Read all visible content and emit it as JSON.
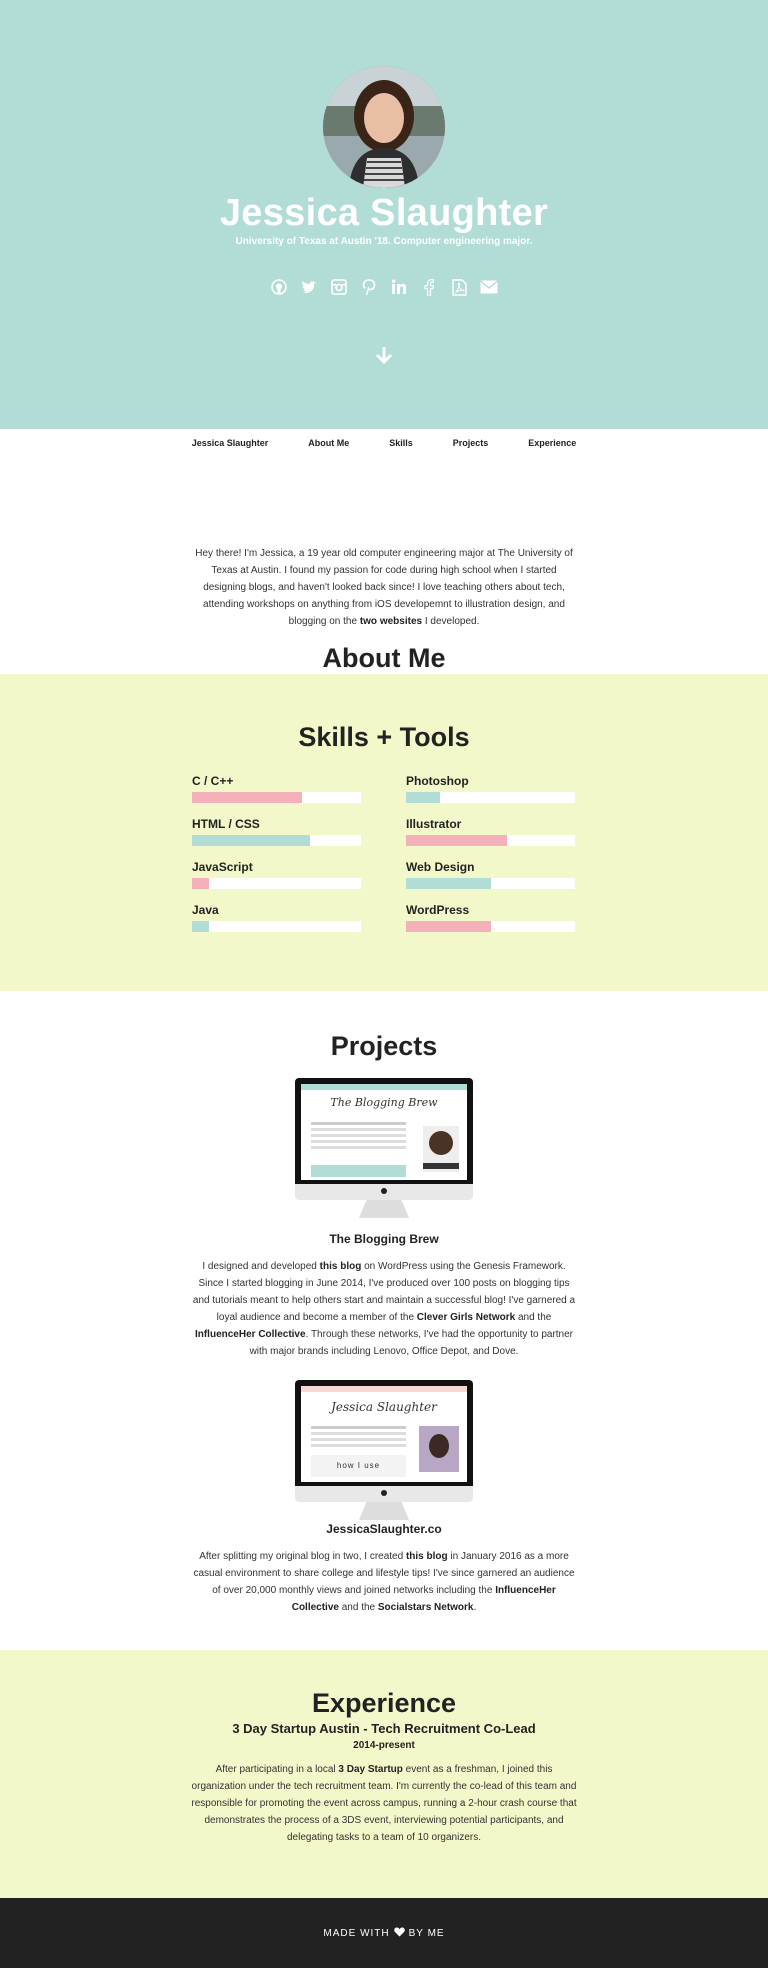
{
  "hero": {
    "name": "Jessica Slaughter",
    "tagline": "University of Texas at Austin '18. Computer engineering major.",
    "social_icons": [
      "github-icon",
      "twitter-icon",
      "instagram-icon",
      "pinterest-icon",
      "linkedin-icon",
      "facebook-icon",
      "pdf-icon",
      "envelope-icon"
    ],
    "down_icon": "arrow-down-icon",
    "bg_color": "#b2dcd6"
  },
  "nav": {
    "items": [
      "Jessica Slaughter",
      "About Me",
      "Skills",
      "Projects",
      "Experience"
    ]
  },
  "about": {
    "title": "About Me",
    "text_before": "Hey there! I'm Jessica, a 19 year old computer engineering major at The University of Texas at Austin. I found my passion for code during high school when I started designing blogs, and haven't looked back since! I love teaching others about tech, attending workshops on anything from iOS developemnt to illustration design, and blogging on the ",
    "text_bold": "two websites",
    "text_after": " I developed."
  },
  "skills": {
    "title": "Skills + Tools",
    "bg_color": "#f2f8c9",
    "pink": "#f4b1b9",
    "teal": "#b2dcd6",
    "items": [
      {
        "name": "C / C++",
        "level": 0.65,
        "color": "pink"
      },
      {
        "name": "Photoshop",
        "level": 0.2,
        "color": "teal"
      },
      {
        "name": "HTML / CSS",
        "level": 0.7,
        "color": "teal"
      },
      {
        "name": "Illustrator",
        "level": 0.6,
        "color": "pink"
      },
      {
        "name": "JavaScript",
        "level": 0.1,
        "color": "pink"
      },
      {
        "name": "Web Design",
        "level": 0.5,
        "color": "teal"
      },
      {
        "name": "Java",
        "level": 0.1,
        "color": "teal"
      },
      {
        "name": "WordPress",
        "level": 0.5,
        "color": "pink"
      }
    ]
  },
  "projects": {
    "title": "Projects",
    "items": [
      {
        "name": "The Blogging Brew",
        "screen_logo": "The Blogging Brew",
        "p1": "I designed and developed ",
        "b1": "this blog",
        "p2": " on WordPress using the Genesis Framework. Since I started blogging in June 2014, I've produced over 100 posts on blogging tips and tutorials meant to help others start and maintain a successful blog! I've garnered a loyal audience and become a member of the ",
        "b2": "Clever Girls Network",
        "p3": " and the ",
        "b3": "InfluenceHer Collective",
        "p4": ". Through these networks, I've had the opportunity to partner with major brands including Lenovo, Office Depot, and Dove."
      },
      {
        "name": "JessicaSlaughter.co",
        "screen_logo": "Jessica Slaughter",
        "screen_text": "how I use",
        "p1": "After splitting my original blog in two, I created ",
        "b1": "this blog",
        "p2": " in January 2016 as a more casual environment to share college and lifestyle tips! I've since garnered an audience of over 20,000 monthly views and joined networks including the ",
        "b2": "InfluenceHer Collective",
        "p3": " and the ",
        "b3": "Socialstars Network",
        "p4": "."
      }
    ]
  },
  "experience": {
    "title": "Experience",
    "role": "3 Day Startup Austin - Tech Recruitment Co-Lead",
    "dates": "2014-present",
    "p1": "After participating in a local ",
    "b1": "3 Day Startup",
    "p2": " event as a freshman, I joined this organization under the tech recruitment team. I'm currently the co-lead of this team and responsible for promoting the event across campus, running a 2-hour crash course that demonstrates the process of a 3DS event, interviewing potential participants, and delegating tasks to a team of 10 organizers."
  },
  "footer": {
    "made_with": "MADE WITH",
    "by_me": "BY ME",
    "icon": "heart-icon"
  }
}
